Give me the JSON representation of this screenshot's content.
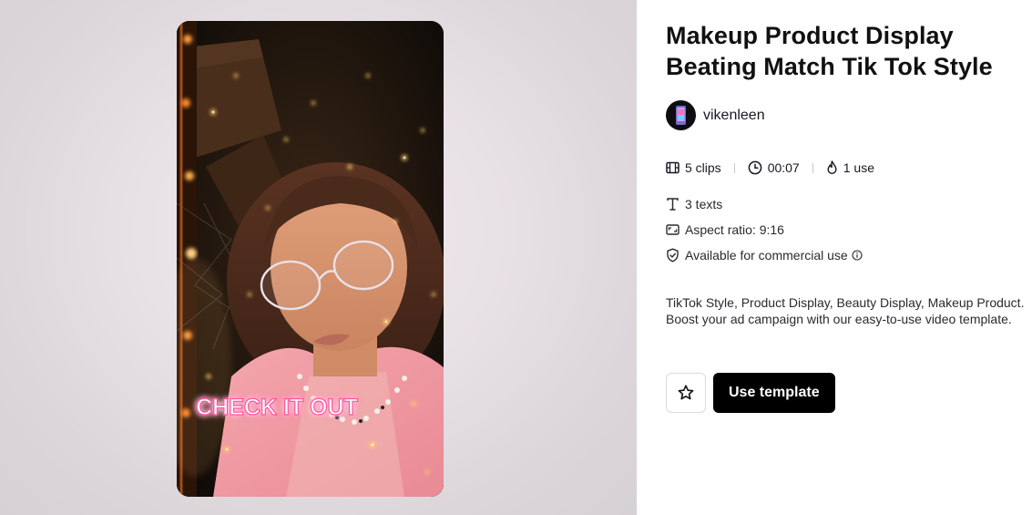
{
  "template": {
    "title": "Makeup Product Display Beating Match Tik Tok Style",
    "author": {
      "name": "vikenleen",
      "avatar_icon": "avatar-image"
    },
    "stats": {
      "clips": "5 clips",
      "duration": "00:07",
      "uses": "1 use"
    },
    "meta": {
      "texts": "3 texts",
      "aspect_ratio": "Aspect ratio: 9:16",
      "commercial": "Available for commercial use"
    },
    "description": "TikTok Style, Product Display, Beauty Display, Makeup Product. Boost your ad campaign with our easy-to-use video template.",
    "actions": {
      "use_template_label": "Use template"
    }
  },
  "preview": {
    "overlay_text": "CHECK IT OUT",
    "overlay_color": "#ffffff",
    "overlay_glow": "#ff4fa0"
  },
  "icons": {
    "clips": "film-icon",
    "duration": "clock-icon",
    "uses": "flame-icon",
    "texts": "text-icon",
    "aspect": "aspect-ratio-icon",
    "commercial": "shield-check-icon",
    "info": "info-icon",
    "favorite": "star-icon"
  }
}
